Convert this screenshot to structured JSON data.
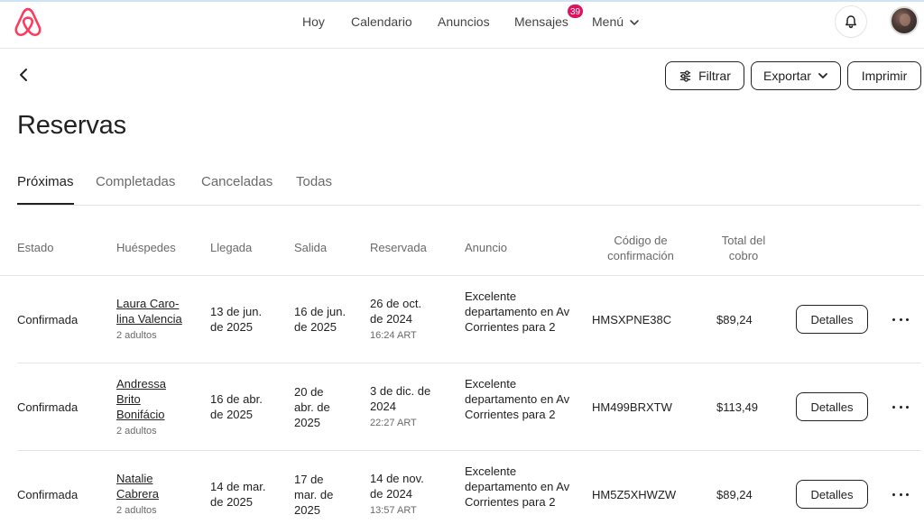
{
  "nav": {
    "items": [
      {
        "label": "Hoy"
      },
      {
        "label": "Calendario"
      },
      {
        "label": "Anuncios"
      },
      {
        "label": "Mensajes"
      },
      {
        "label": "Menú"
      }
    ],
    "messages_badge": "39"
  },
  "toolbar": {
    "filter_label": "Filtrar",
    "export_label": "Exportar",
    "print_label": "Imprimir"
  },
  "page": {
    "title": "Reservas"
  },
  "tabs": [
    {
      "label": "Próximas",
      "active": true
    },
    {
      "label": "Completadas"
    },
    {
      "label": "Canceladas"
    },
    {
      "label": "Todas"
    }
  ],
  "table": {
    "headers": {
      "estado": "Estado",
      "huespedes": "Huéspedes",
      "llegada": "Llegada",
      "salida": "Salida",
      "reservada": "Reservada",
      "anuncio": "Anuncio",
      "codigo": "Código de confirmación",
      "total": "Total del cobro"
    },
    "details_label": "Detalles",
    "rows": [
      {
        "estado": "Confirmada",
        "guest_name": "Laura Caro-lina Valencia",
        "guests": "2 adultos",
        "llegada": "13 de jun. de 2025",
        "salida": "16 de jun. de 2025",
        "reservada": "26 de oct. de 2024",
        "reservada_time": "16:24 ART",
        "anuncio": "Excelente departamento en Av Corrientes para 2",
        "codigo": "HMSXPNE38C",
        "total": "$89,24"
      },
      {
        "estado": "Confirmada",
        "guest_name": "Andressa Brito Bonifácio",
        "guests": "2 adultos",
        "llegada": "16 de abr. de 2025",
        "salida": "20 de abr. de 2025",
        "reservada": "3 de dic. de 2024",
        "reservada_time": "22:27 ART",
        "anuncio": "Excelente departamento en Av Corrientes para 2",
        "codigo": "HM499BRXTW",
        "total": "$113,49"
      },
      {
        "estado": "Confirmada",
        "guest_name": "Natalie Cabrera",
        "guests": "2 adultos",
        "llegada": "14 de mar. de 2025",
        "salida": "17 de mar. de 2025",
        "reservada": "14 de nov. de 2024",
        "reservada_time": "13:57 ART",
        "anuncio": "Excelente departamento en Av Corrientes para 2",
        "codigo": "HM5Z5XHWZW",
        "total": "$89,24"
      }
    ]
  },
  "colors": {
    "brand": "#FF385C",
    "badge": "#E0115F"
  },
  "icons": [
    "airbnb-logo-icon",
    "chevron-down-icon",
    "bell-icon",
    "chevron-left-icon",
    "filter-sliders-icon",
    "more-dots-icon"
  ]
}
